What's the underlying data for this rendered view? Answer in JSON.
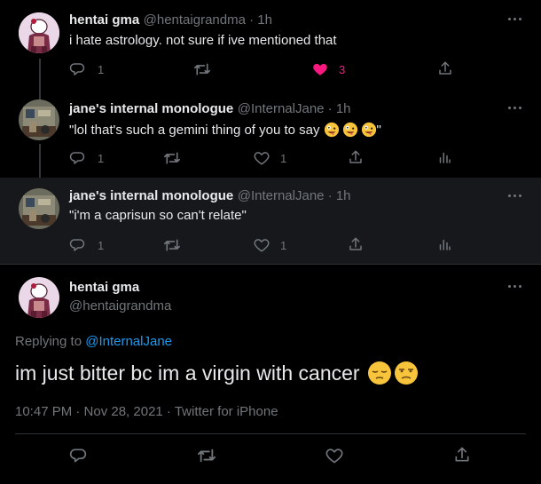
{
  "tweets": [
    {
      "name": "hentai gma",
      "handle": "@hentaigrandma · 1h",
      "text": "i hate astrology. not sure if ive mentioned that",
      "replies": "1",
      "likes": "3"
    },
    {
      "name": "jane's internal monologue",
      "handle": "@InternalJane · 1h",
      "text": "\"lol that's such a gemini thing of you to say",
      "text_end": "\"",
      "replies": "1",
      "likes": "1"
    },
    {
      "name": "jane's internal monologue",
      "handle": "@InternalJane · 1h",
      "text": "\"i'm a caprisun so can't relate\"",
      "replies": "1",
      "likes": "1"
    }
  ],
  "main_tweet": {
    "name": "hentai gma",
    "handle": "@hentaigrandma",
    "replying_to_label": "Replying to",
    "replying_to_handle": "@InternalJane",
    "text": "im just bitter bc im a virgin with cancer",
    "meta": "10:47 PM · Nov 28, 2021 · Twitter for iPhone"
  },
  "colors": {
    "background": "#000000",
    "highlight_row": "#16181c",
    "text": "#e7e9ea",
    "muted": "#71767b",
    "link": "#1d9bf0",
    "like": "#f91880"
  },
  "icons": [
    "reply-icon",
    "retweet-icon",
    "like-icon",
    "share-icon",
    "analytics-icon",
    "more-icon",
    "zany-face-emoji",
    "pensive-face-emoji",
    "unamused-face-emoji"
  ]
}
